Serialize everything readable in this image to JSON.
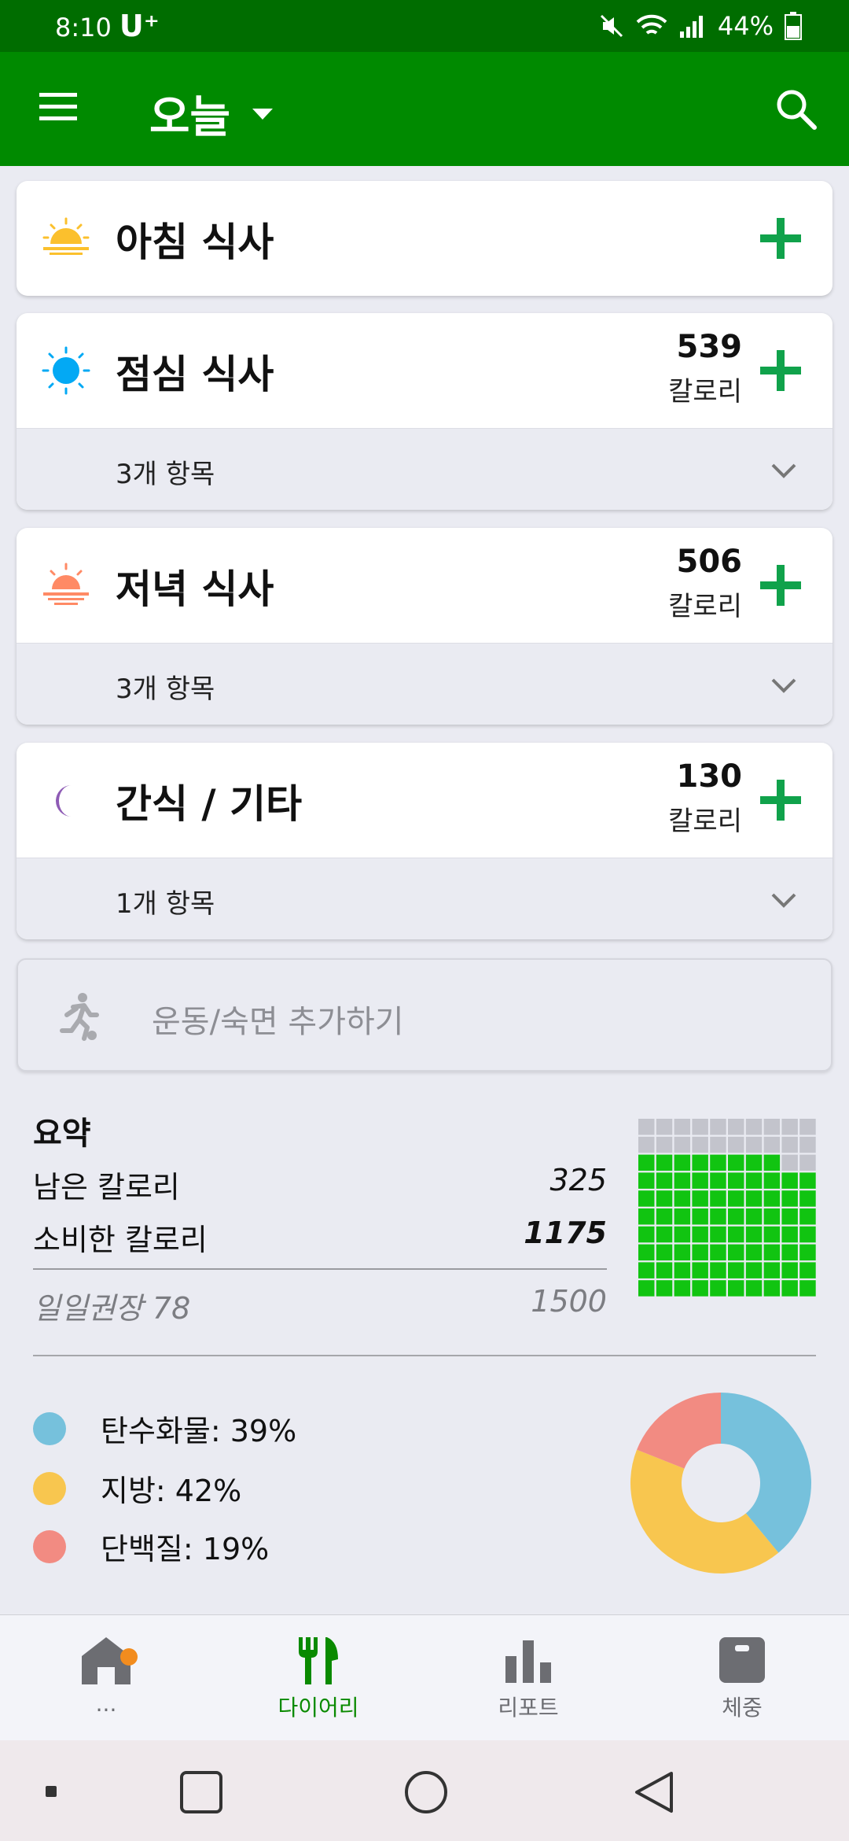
{
  "status": {
    "time": "8:10",
    "carrier": "U⁺",
    "battery": "44%"
  },
  "header": {
    "title": "오늘"
  },
  "meals": [
    {
      "title": "아침 식사",
      "icon": "sunrise-icon",
      "calories": "",
      "unit": "",
      "count": ""
    },
    {
      "title": "점심 식사",
      "icon": "sun-icon",
      "calories": "539",
      "unit": "칼로리",
      "count": "3개 항목"
    },
    {
      "title": "저녁 식사",
      "icon": "sunset-icon",
      "calories": "506",
      "unit": "칼로리",
      "count": "3개 항목"
    },
    {
      "title": "간식 / 기타",
      "icon": "moon-icon",
      "calories": "130",
      "unit": "칼로리",
      "count": "1개 항목"
    }
  ],
  "exercise": {
    "label": "운동/숙면 추가하기"
  },
  "summary": {
    "title": "요약",
    "remaining_label": "남은 칼로리",
    "remaining_value": "325",
    "consumed_label": "소비한 칼로리",
    "consumed_value": "1175",
    "daily_label": "일일권장 78",
    "daily_value": "1500",
    "progress_fraction": 0.78
  },
  "macros": [
    {
      "label": "탄수화물: 39%",
      "percent": 39,
      "color": "#76c1dc"
    },
    {
      "label": "지방: 42%",
      "percent": 42,
      "color": "#f8c64f"
    },
    {
      "label": "단백질: 19%",
      "percent": 19,
      "color": "#f28b82"
    }
  ],
  "nav": [
    {
      "label": "...",
      "icon": "home-icon"
    },
    {
      "label": "다이어리",
      "icon": "fork-knife-icon"
    },
    {
      "label": "리포트",
      "icon": "bar-chart-icon"
    },
    {
      "label": "체중",
      "icon": "scale-icon"
    }
  ],
  "colors": {
    "brand": "#008a00",
    "status": "#006d00",
    "accent": "#10a24b",
    "grid_on": "#11c411",
    "grid_off": "#c3c4cc"
  }
}
